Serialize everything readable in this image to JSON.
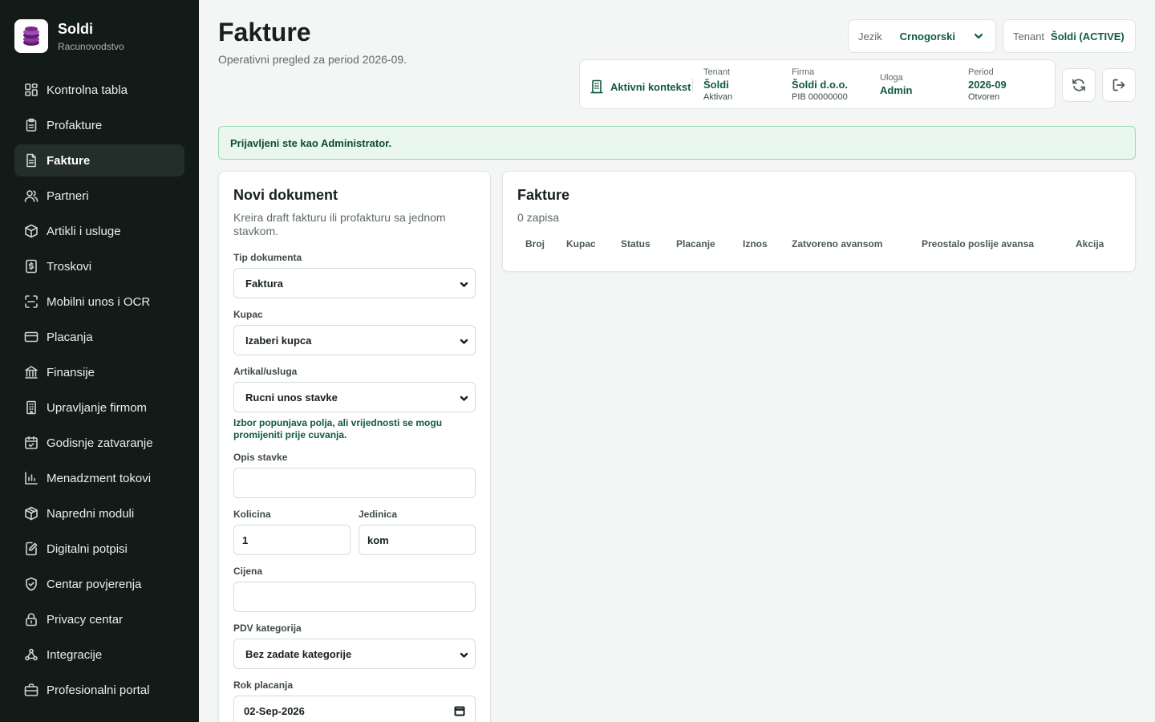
{
  "brand": {
    "name": "Soldi",
    "subtitle": "Racunovodstvo"
  },
  "sidebar": {
    "items": [
      {
        "label": "Kontrolna tabla",
        "icon": "dashboard-icon",
        "active": false
      },
      {
        "label": "Profakture",
        "icon": "clipboard-icon",
        "active": false
      },
      {
        "label": "Fakture",
        "icon": "document-icon",
        "active": true
      },
      {
        "label": "Partneri",
        "icon": "users-icon",
        "active": false
      },
      {
        "label": "Artikli i usluge",
        "icon": "package-icon",
        "active": false
      },
      {
        "label": "Troskovi",
        "icon": "receipt-icon",
        "active": false
      },
      {
        "label": "Mobilni unos i OCR",
        "icon": "scan-icon",
        "active": false
      },
      {
        "label": "Placanja",
        "icon": "credit-card-icon",
        "active": false
      },
      {
        "label": "Finansije",
        "icon": "bank-icon",
        "active": false
      },
      {
        "label": "Upravljanje firmom",
        "icon": "building-icon",
        "active": false
      },
      {
        "label": "Godisnje zatvaranje",
        "icon": "calendar-check-icon",
        "active": false
      },
      {
        "label": "Menadzment tokovi",
        "icon": "bar-chart-icon",
        "active": false
      },
      {
        "label": "Napredni moduli",
        "icon": "cube-icon",
        "active": false
      },
      {
        "label": "Digitalni potpisi",
        "icon": "signature-icon",
        "active": false
      },
      {
        "label": "Centar povjerenja",
        "icon": "shield-check-icon",
        "active": false
      },
      {
        "label": "Privacy centar",
        "icon": "lock-icon",
        "active": false
      },
      {
        "label": "Integracije",
        "icon": "webhook-icon",
        "active": false
      },
      {
        "label": "Profesionalni portal",
        "icon": "briefcase-icon",
        "active": false
      }
    ]
  },
  "header": {
    "title": "Fakture",
    "subtitle": "Operativni pregled za period 2026-09.",
    "language": {
      "label": "Jezik",
      "value": "Crnogorski"
    },
    "tenant": {
      "label": "Tenant",
      "value": "Šoldi (ACTIVE)"
    }
  },
  "context": {
    "label": "Aktivni kontekst",
    "tenant": {
      "key": "Tenant",
      "value": "Šoldi",
      "sub": "Aktivan"
    },
    "firma": {
      "key": "Firma",
      "value": "Šoldi d.o.o.",
      "sub": "PIB 00000000"
    },
    "uloga": {
      "key": "Uloga",
      "value": "Admin"
    },
    "period": {
      "key": "Period",
      "value": "2026-09",
      "sub": "Otvoren"
    }
  },
  "alert": {
    "text": "Prijavljeni ste kao Administrator."
  },
  "form": {
    "title": "Novi dokument",
    "subtitle": "Kreira draft fakturu ili profakturu sa jednom stavkom.",
    "doc_type": {
      "label": "Tip dokumenta",
      "value": "Faktura"
    },
    "buyer": {
      "label": "Kupac",
      "value": "Izaberi kupca"
    },
    "item": {
      "label": "Artikal/usluga",
      "value": "Rucni unos stavke"
    },
    "hint": "Izbor popunjava polja, ali vrijednosti se mogu promijeniti prije cuvanja.",
    "description": {
      "label": "Opis stavke",
      "value": ""
    },
    "quantity": {
      "label": "Kolicina",
      "value": "1"
    },
    "unit": {
      "label": "Jedinica",
      "value": "kom"
    },
    "price": {
      "label": "Cijena",
      "value": ""
    },
    "vat": {
      "label": "PDV kategorija",
      "value": "Bez zadate kategorije"
    },
    "due": {
      "label": "Rok placanja",
      "value": "02-Sep-2026"
    }
  },
  "list": {
    "title": "Fakture",
    "count": "0 zapisa",
    "columns": [
      "Broj",
      "Kupac",
      "Status",
      "Placanje",
      "Iznos",
      "Zatvoreno avansom",
      "Preostalo poslije avansa",
      "Akcija"
    ]
  },
  "colors": {
    "sidebar_bg": "#131b19",
    "accent": "#0f5a45",
    "alert_bg": "#e9f7ef",
    "alert_border": "#9ad8b4",
    "logo": "#7b2a8c"
  }
}
